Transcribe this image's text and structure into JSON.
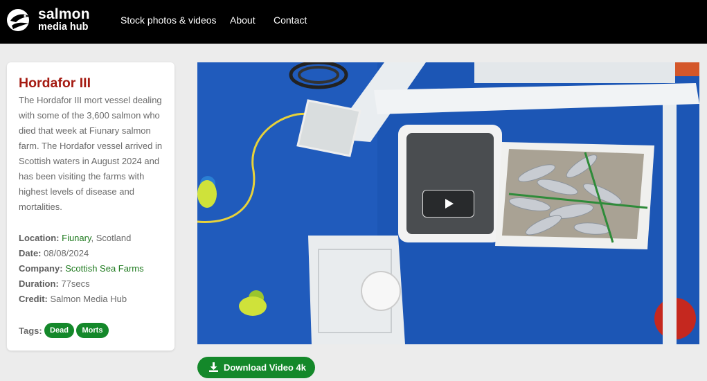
{
  "brand": {
    "line1": "salmon",
    "line2": "media hub"
  },
  "nav": {
    "stock": "Stock photos & videos",
    "about": "About",
    "contact": "Contact"
  },
  "item": {
    "title": "Hordafor III",
    "description": "The Hordafor III mort vessel dealing with some of the 3,600 salmon who died that week at Fiunary salmon farm. The Hordafor vessel arrived in Scottish waters in August 2024 and has been visiting the farms with highest levels of disease and mortalities.",
    "location_label": "Location:",
    "location_link": "Fiunary",
    "location_rest": ", Scotland",
    "date_label": "Date:",
    "date": "08/08/2024",
    "company_label": "Company:",
    "company": "Scottish Sea Farms",
    "duration_label": "Duration:",
    "duration": "77secs",
    "credit_label": "Credit:",
    "credit": "Salmon Media Hub",
    "tags_label": "Tags:",
    "tags": [
      "Dead",
      "Morts"
    ]
  },
  "video": {
    "play_icon": "play-icon"
  },
  "download": {
    "label": "Download Video 4k",
    "icon": "download-icon"
  },
  "colors": {
    "accent_green": "#14882a",
    "title_red": "#a51b12",
    "header_bg": "#000000"
  }
}
